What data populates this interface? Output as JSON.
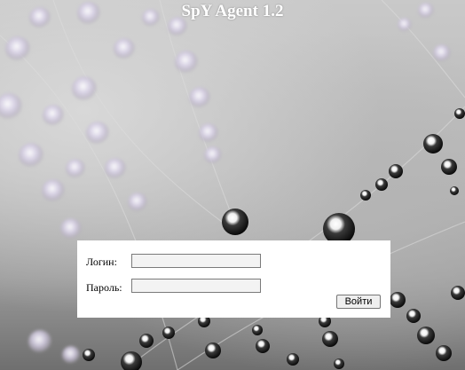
{
  "app": {
    "title": "SpY Agent 1.2"
  },
  "login_form": {
    "login_label": "Логин:",
    "login_value": "",
    "password_label": "Пароль:",
    "password_value": "",
    "submit_label": "Войти"
  },
  "background": {
    "image": "dew-drops-on-spider-web",
    "colors": {
      "base": "#b9b9b9",
      "drop_highlight": "#ffffff",
      "drop_shadow": "#1a1a1a",
      "drop_tint": "#c9b8e6"
    }
  }
}
